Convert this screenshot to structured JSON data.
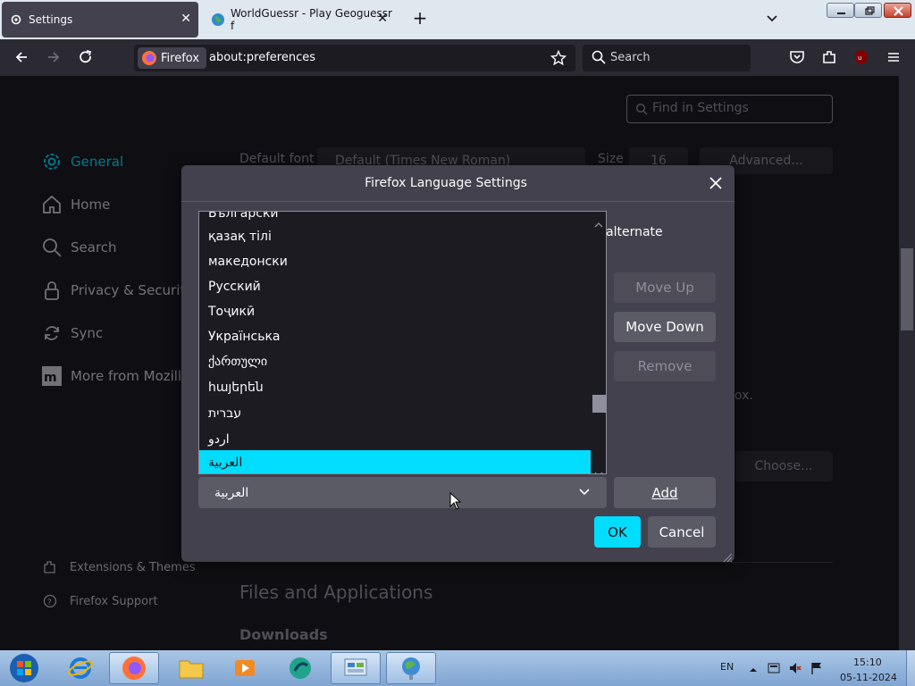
{
  "browser": {
    "tabs": [
      {
        "label": "Settings",
        "icon": "gear-icon"
      },
      {
        "label": "WorldGuessr - Play Geoguessr f",
        "icon": "globe-icon"
      }
    ],
    "firefox_chip": "Firefox",
    "url": "about:preferences",
    "search_placeholder": "Search"
  },
  "settings": {
    "find_placeholder": "Find in Settings",
    "sidebar": [
      {
        "label": "General",
        "icon": "gear-icon"
      },
      {
        "label": "Home",
        "icon": "home-icon"
      },
      {
        "label": "Search",
        "icon": "search-icon"
      },
      {
        "label": "Privacy & Security",
        "icon": "lock-icon"
      },
      {
        "label": "Sync",
        "icon": "sync-icon"
      },
      {
        "label": "More from Mozill",
        "icon": "mozilla-icon"
      }
    ],
    "sidebar_footer": [
      {
        "label": "Extensions & Themes",
        "icon": "puzzle-icon"
      },
      {
        "label": "Firefox Support",
        "icon": "help-icon"
      }
    ],
    "default_font_label": "Default font",
    "default_font_value": "Default (Times New Roman)",
    "size_label": "Size",
    "size_value": "16",
    "advanced_label": "Advanced...",
    "ox_fragment": "ox.",
    "choose_label": "Choose...",
    "files_heading": "Files and Applications",
    "downloads_heading": "Downloads"
  },
  "dialog": {
    "title": "Firefox Language Settings",
    "alternate_text": "alternate",
    "languages": [
      "Български",
      "қазақ тілі",
      "македонски",
      "Русский",
      "Тоҷикӣ",
      "Українська",
      "ქართული",
      "հայերեն",
      "עברית",
      "اردو",
      "العربية"
    ],
    "selected_language": "العربية",
    "select_value": "العربية",
    "buttons": {
      "move_up": "Move Up",
      "move_down": "Move Down",
      "remove": "Remove",
      "add": "Add",
      "ok": "OK",
      "cancel": "Cancel"
    }
  },
  "taskbar": {
    "lang": "EN",
    "time": "15:10",
    "date": "05-11-2024"
  },
  "colors": {
    "accent": "#00ddff",
    "dialog_bg": "#42414d",
    "page_bg": "#1c1b22"
  }
}
